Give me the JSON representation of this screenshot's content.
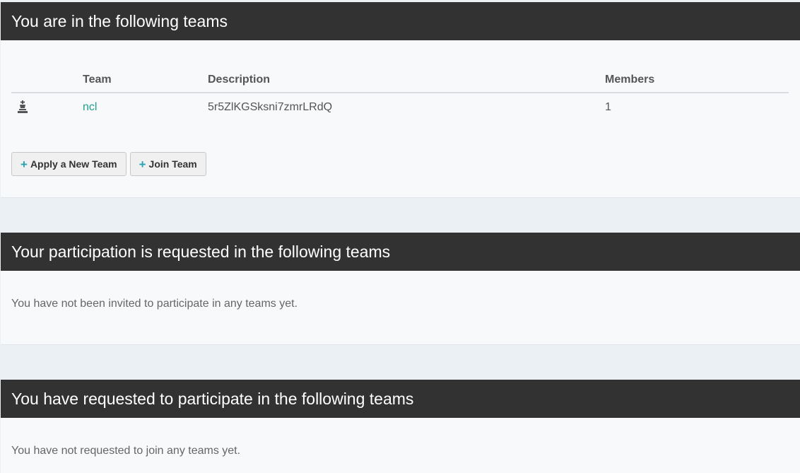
{
  "teams_panel": {
    "title": "You are in the following teams",
    "columns": {
      "team": "Team",
      "description": "Description",
      "members": "Members"
    },
    "rows": [
      {
        "icon": "chess-king-icon",
        "team": "ncl",
        "description": "5r5ZlKGSksni7zmrLRdQ",
        "members": "1"
      }
    ],
    "buttons": {
      "apply": "Apply a New Team",
      "join": "Join Team"
    }
  },
  "invited_panel": {
    "title": "Your participation is requested in the following teams",
    "empty_message": "You have not been invited to participate in any teams yet."
  },
  "requested_panel": {
    "title": "You have requested to participate in the following teams",
    "empty_message": "You have not requested to join any teams yet."
  },
  "colors": {
    "header_bg": "#323232",
    "link": "#23a08c",
    "plus": "#2aa0b4"
  }
}
